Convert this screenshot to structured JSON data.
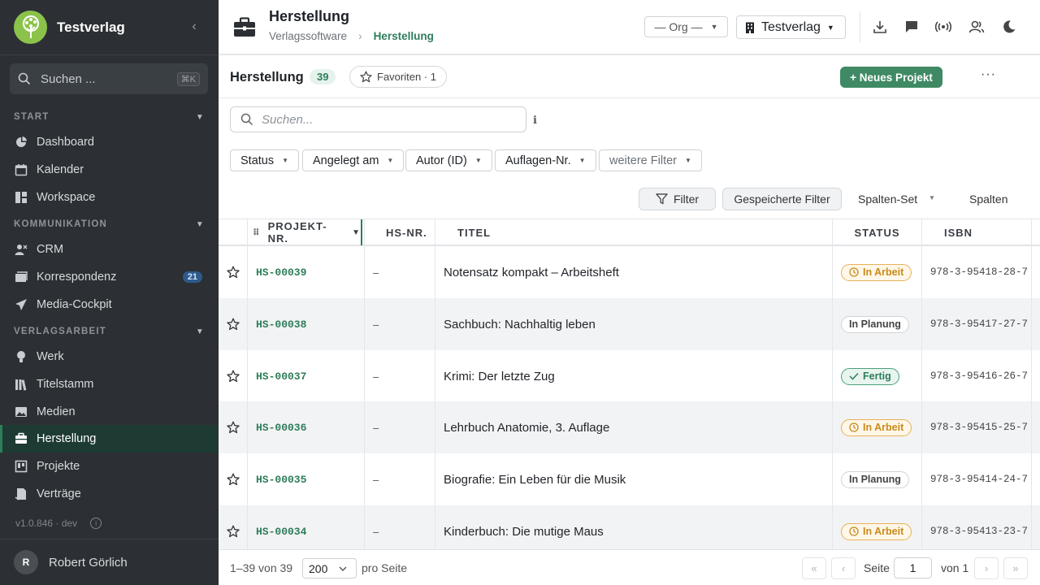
{
  "brand": {
    "name": "Testverlag"
  },
  "sidebar": {
    "search_placeholder": "Suchen ...",
    "search_shortcut": "⌘K",
    "sections": [
      {
        "label": "START",
        "items": [
          {
            "label": "Dashboard",
            "icon": "dashboard-icon"
          },
          {
            "label": "Kalender",
            "icon": "calendar-icon"
          },
          {
            "label": "Workspace",
            "icon": "workspace-icon"
          }
        ]
      },
      {
        "label": "KOMMUNIKATION",
        "items": [
          {
            "label": "CRM",
            "icon": "users-icon"
          },
          {
            "label": "Korrespondenz",
            "icon": "inbox-icon",
            "badge": "21"
          },
          {
            "label": "Media-Cockpit",
            "icon": "send-icon"
          }
        ]
      },
      {
        "label": "VERLAGSARBEIT",
        "items": [
          {
            "label": "Werk",
            "icon": "lightbulb-icon"
          },
          {
            "label": "Titelstamm",
            "icon": "books-icon"
          },
          {
            "label": "Medien",
            "icon": "image-icon"
          },
          {
            "label": "Herstellung",
            "icon": "briefcase-icon",
            "active": true
          },
          {
            "label": "Projekte",
            "icon": "board-icon"
          },
          {
            "label": "Verträge",
            "icon": "contract-icon"
          }
        ]
      }
    ],
    "version": "v1.0.846 · dev",
    "user": {
      "initial": "R",
      "name": "Robert Görlich"
    }
  },
  "header": {
    "title": "Herstellung",
    "breadcrumb": [
      "Verlagssoftware",
      "Herstellung"
    ],
    "org_select": "— Org —",
    "publisher_select": "Testverlag"
  },
  "toolbar": {
    "title": "Herstellung",
    "count": "39",
    "favorites_label": "Favoriten · 1",
    "new_project_label": "+ Neues Projekt",
    "more_label": "···"
  },
  "search": {
    "placeholder": "Suchen..."
  },
  "filters": [
    "Status",
    "Angelegt am",
    "Autor (ID)",
    "Auflagen-Nr.",
    "weitere Filter"
  ],
  "actions": {
    "filter_label": "Filter",
    "saved_filters_label": "Gespeicherte Filter",
    "column_set_label": "Spalten-Set",
    "columns_label": "Spalten"
  },
  "table": {
    "columns": [
      "PROJEKT-NR.",
      "HS-NR.",
      "TITEL",
      "STATUS",
      "ISBN"
    ],
    "rows": [
      {
        "id": "HS-00039",
        "hs": "–",
        "title": "Notensatz kompakt – Arbeitsheft",
        "status": "In Arbeit",
        "status_type": "arbeit",
        "isbn": "978-3-95418-28-7"
      },
      {
        "id": "HS-00038",
        "hs": "–",
        "title": "Sachbuch: Nachhaltig leben",
        "status": "In Planung",
        "status_type": "planung",
        "isbn": "978-3-95417-27-7"
      },
      {
        "id": "HS-00037",
        "hs": "–",
        "title": "Krimi: Der letzte Zug",
        "status": "Fertig",
        "status_type": "fertig",
        "isbn": "978-3-95416-26-7"
      },
      {
        "id": "HS-00036",
        "hs": "–",
        "title": "Lehrbuch Anatomie, 3. Auflage",
        "status": "In Arbeit",
        "status_type": "arbeit",
        "isbn": "978-3-95415-25-7"
      },
      {
        "id": "HS-00035",
        "hs": "–",
        "title": "Biografie: Ein Leben für die Musik",
        "status": "In Planung",
        "status_type": "planung",
        "isbn": "978-3-95414-24-7"
      },
      {
        "id": "HS-00034",
        "hs": "–",
        "title": "Kinderbuch: Die mutige Maus",
        "status": "In Arbeit",
        "status_type": "arbeit",
        "isbn": "978-3-95413-23-7"
      }
    ]
  },
  "pagination": {
    "range": "1–39 von 39",
    "per_page": "200",
    "per_page_label": "pro Seite",
    "page_label": "Seite",
    "page": "1",
    "of_label": "von 1"
  },
  "colors": {
    "accent": "#2e7d5b",
    "sidebar_bg": "#2c3034",
    "in_arbeit": "#c98a1a",
    "fertig": "#2e7d5b"
  }
}
